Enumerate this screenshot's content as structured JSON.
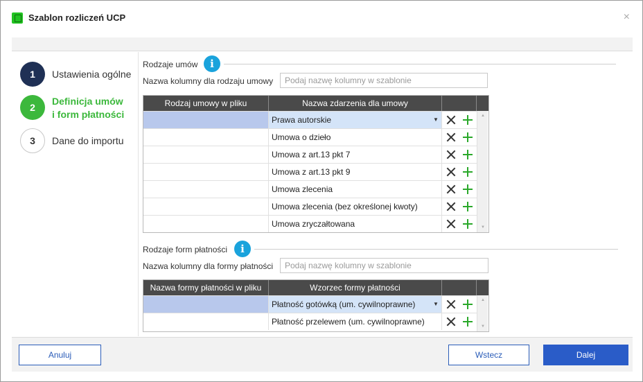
{
  "window": {
    "title": "Szablon rozliczeń UCP",
    "close_label": "×"
  },
  "steps": [
    {
      "number": "1",
      "label": "Ustawienia ogólne"
    },
    {
      "number": "2",
      "label_line1": "Definicja umów",
      "label_line2": "i form płatności"
    },
    {
      "number": "3",
      "label": "Dane do importu"
    }
  ],
  "contracts": {
    "section_title": "Rodzaje umów",
    "info_icon": "i",
    "column_label": "Nazwa kolumny dla rodzaju umowy",
    "column_placeholder": "Podaj nazwę kolumny w szablonie",
    "headers": [
      "Rodzaj umowy w pliku",
      "Nazwa zdarzenia dla umowy"
    ],
    "rows": [
      {
        "file_type": "",
        "event_name": "Prawa autorskie"
      },
      {
        "file_type": "",
        "event_name": "Umowa o dzieło"
      },
      {
        "file_type": "",
        "event_name": "Umowa z art.13 pkt 7"
      },
      {
        "file_type": "",
        "event_name": "Umowa z art.13 pkt 9"
      },
      {
        "file_type": "",
        "event_name": "Umowa zlecenia"
      },
      {
        "file_type": "",
        "event_name": "Umowa zlecenia (bez określonej kwoty)"
      },
      {
        "file_type": "",
        "event_name": "Umowa zryczałtowana"
      }
    ]
  },
  "payments": {
    "section_title": "Rodzaje form płatności",
    "info_icon": "i",
    "column_label": "Nazwa kolumny dla formy płatności",
    "column_placeholder": "Podaj nazwę kolumny w szablonie",
    "headers": [
      "Nazwa formy płatności w pliku",
      "Wzorzec formy płatności"
    ],
    "rows": [
      {
        "file_type": "",
        "pattern": "Płatność gotówką (um. cywilnoprawne)"
      },
      {
        "file_type": "",
        "pattern": "Płatność przelewem (um. cywilnoprawne)"
      }
    ]
  },
  "icons": {
    "dropdown": "▼",
    "scroll_up": "▲",
    "scroll_down": "▼"
  },
  "footer": {
    "cancel": "Anuluj",
    "back": "Wstecz",
    "next": "Dalej"
  },
  "colors": {
    "accent": "#2a5cc8",
    "step_active": "#3cb83c",
    "step_done": "#1f3055",
    "info": "#1aa3dc"
  }
}
